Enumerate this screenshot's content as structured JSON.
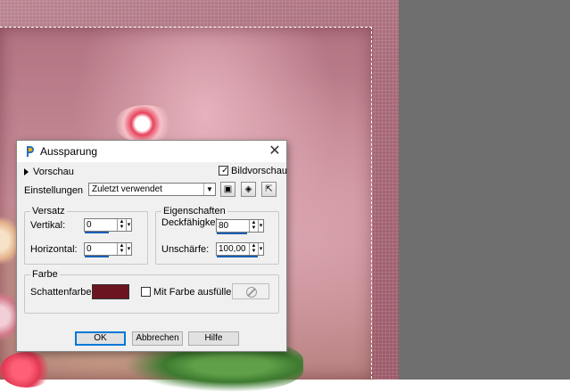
{
  "dialog": {
    "title": "Aussparung",
    "preview_label": "Vorschau",
    "image_preview_label": "Bildvorschau",
    "image_preview_checked": true,
    "settings_label": "Einstellungen",
    "settings_value": "Zuletzt verwendet"
  },
  "offset": {
    "legend": "Versatz",
    "vertical_label": "Vertikal:",
    "vertical_value": "0",
    "horizontal_label": "Horizontal:",
    "horizontal_value": "0"
  },
  "properties": {
    "legend": "Eigenschaften",
    "opacity_label": "Deckfähigkeit:",
    "opacity_value": "80",
    "blur_label": "Unschärfe:",
    "blur_value": "100,00"
  },
  "color": {
    "legend": "Farbe",
    "shadow_color_label": "Schattenfarbe:",
    "shadow_color": "#6b1520",
    "fill_with_color_label": "Mit Farbe ausfüllen:",
    "fill_with_color_checked": false
  },
  "buttons": {
    "ok": "OK",
    "cancel": "Abbrechen",
    "help": "Hilfe"
  },
  "icons": {
    "app": "paintshop-pro-icon",
    "close": "close-icon",
    "save_preset": "save-preset-icon",
    "reset_preset": "reset-cube-icon",
    "load_preset": "load-preset-icon",
    "no_color": "no-color-icon"
  }
}
